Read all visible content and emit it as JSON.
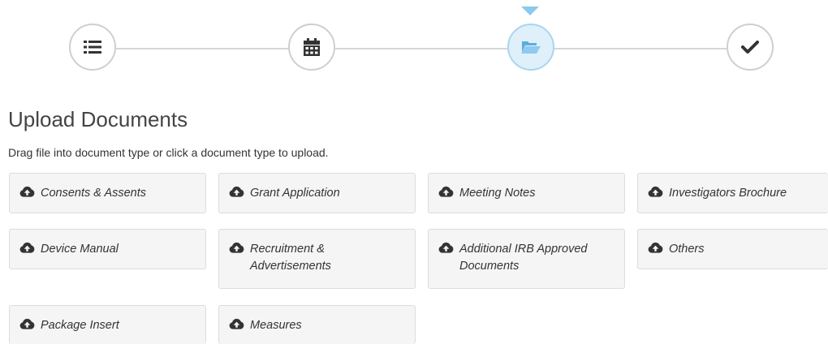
{
  "stepper": {
    "steps": [
      {
        "icon": "list-icon",
        "state": "complete"
      },
      {
        "icon": "calendar-icon",
        "state": "complete"
      },
      {
        "icon": "folder-open-icon",
        "state": "active"
      },
      {
        "icon": "checkmark-icon",
        "state": "pending"
      }
    ],
    "active_color": "#dff0fa"
  },
  "page": {
    "title": "Upload Documents",
    "instructions": "Drag file into document type or click a document type to upload."
  },
  "document_types": [
    {
      "label": "Consents & Assents",
      "icon": "cloud-upload-icon"
    },
    {
      "label": "Grant Application",
      "icon": "cloud-upload-icon"
    },
    {
      "label": "Meeting Notes",
      "icon": "cloud-upload-icon"
    },
    {
      "label": "Investigators Brochure",
      "icon": "cloud-upload-icon"
    },
    {
      "label": "Device Manual",
      "icon": "cloud-upload-icon"
    },
    {
      "label": "Recruitment & Advertisements",
      "icon": "cloud-upload-icon"
    },
    {
      "label": "Additional IRB Approved Documents",
      "icon": "cloud-upload-icon"
    },
    {
      "label": "Others",
      "icon": "cloud-upload-icon"
    },
    {
      "label": "Package Insert",
      "icon": "cloud-upload-icon"
    },
    {
      "label": "Measures",
      "icon": "cloud-upload-icon"
    }
  ]
}
